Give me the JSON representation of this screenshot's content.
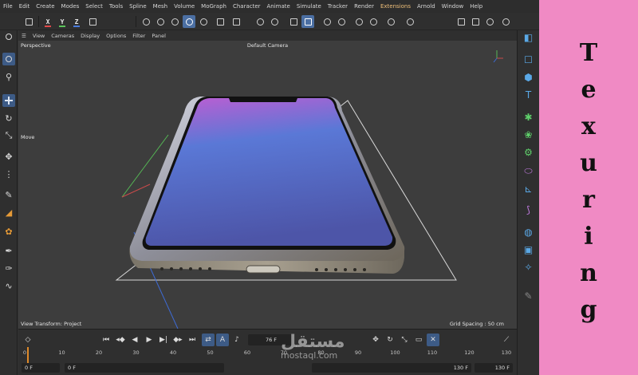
{
  "menubar": {
    "items": [
      "File",
      "Edit",
      "Create",
      "Modes",
      "Select",
      "Tools",
      "Spline",
      "Mesh",
      "Volume",
      "MoGraph",
      "Character",
      "Animate",
      "Simulate",
      "Tracker",
      "Render",
      "Extensions",
      "Arnold",
      "Window",
      "Help"
    ],
    "accent_item": "Extensions",
    "accent_color": "#f0c07a"
  },
  "toolbar": {
    "axis_x": "X",
    "axis_y": "Y",
    "axis_z": "Z"
  },
  "viewport": {
    "menu": [
      "View",
      "Cameras",
      "Display",
      "Options",
      "Filter",
      "Panel"
    ],
    "label": "Perspective",
    "camera": "Default Camera",
    "move_label": "Move",
    "transform_label": "View Transform: Project",
    "grid_label": "Grid Spacing : 50 cm",
    "background_color": "#3d3d3d",
    "screen_gradient": [
      "#c25cd2",
      "#5a78d6",
      "#4d55a8"
    ]
  },
  "timeline": {
    "current_frame": "76 F",
    "ticks": [
      "0",
      "10",
      "20",
      "30",
      "40",
      "50",
      "60",
      "70",
      "80",
      "90",
      "100",
      "110",
      "120",
      "130"
    ],
    "start_field": "0 F",
    "start_field_2": "0 F",
    "end_field": "130 F",
    "end_field_2": "130 F",
    "playhead_color": "#e08a2a"
  },
  "watermark": {
    "arabic": "مستقل",
    "latin": "mostaql.com"
  },
  "side_title": {
    "letters": [
      "T",
      "e",
      "x",
      "u",
      "r",
      "i",
      "n",
      "g"
    ],
    "background": "#f08ac4"
  },
  "colors": {
    "axis_x": "#e04a4a",
    "axis_y": "#5ac35a",
    "axis_z": "#4a7bdc",
    "selection": "#3d5b86"
  }
}
